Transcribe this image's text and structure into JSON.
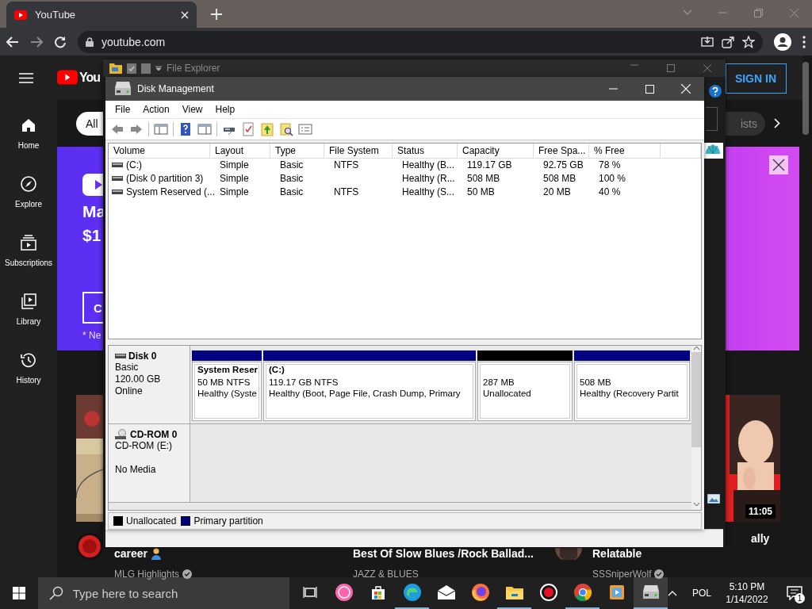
{
  "browser": {
    "tab": {
      "title": "YouTube"
    },
    "address": "youtube.com"
  },
  "youtube": {
    "logo_text": "You",
    "sign_in": "SIGN IN",
    "sidebar": [
      {
        "kind": "home",
        "label": "Home"
      },
      {
        "kind": "explore",
        "label": "Explore"
      },
      {
        "kind": "subscriptions",
        "label": "Subscriptions"
      },
      {
        "kind": "library",
        "label": "Library"
      },
      {
        "kind": "history",
        "label": "History"
      }
    ],
    "chips": [
      "All",
      "ists"
    ],
    "banner": {
      "heading_lines": [
        "Ma",
        "$1"
      ],
      "button": "C",
      "note": "* Ne"
    },
    "duration": "11:05",
    "videos": [
      {
        "title": "career",
        "channel": "MLG Highlights"
      },
      {
        "title": "Best Of Slow Blues /Rock Ballad...",
        "channel": "JAZZ & BLUES"
      },
      {
        "title_fragment": "ally",
        "title": "Relatable",
        "channel": "SSSniperWolf"
      }
    ]
  },
  "file_explorer": {
    "title": "File Explorer"
  },
  "disk_management": {
    "title": "Disk Management",
    "menu": [
      "File",
      "Action",
      "View",
      "Help"
    ],
    "columns": [
      "Volume",
      "Layout",
      "Type",
      "File System",
      "Status",
      "Capacity",
      "Free Spa...",
      "% Free"
    ],
    "rows": [
      [
        "(C:)",
        "Simple",
        "Basic",
        "NTFS",
        "Healthy (B...",
        "119.17 GB",
        "92.75 GB",
        "78 %"
      ],
      [
        "(Disk 0 partition 3)",
        "Simple",
        "Basic",
        "",
        "Healthy (R...",
        "508 MB",
        "508 MB",
        "100 %"
      ],
      [
        "System Reserved (...",
        "Simple",
        "Basic",
        "NTFS",
        "Healthy (S...",
        "50 MB",
        "20 MB",
        "40 %"
      ]
    ],
    "disks": [
      {
        "kind": "disk",
        "name": "Disk 0",
        "lines": [
          "Basic",
          "120.00 GB",
          "Online"
        ],
        "partitions": [
          {
            "kind": "primary",
            "name": "System Reser",
            "lines": [
              "50 MB NTFS",
              "Healthy (Syste"
            ]
          },
          {
            "kind": "primary",
            "name": "(C:)",
            "lines": [
              "119.17 GB NTFS",
              "Healthy (Boot, Page File, Crash Dump, Primary"
            ]
          },
          {
            "kind": "unallocated",
            "lines": [
              "287 MB",
              "Unallocated"
            ]
          },
          {
            "kind": "primary",
            "lines": [
              "508 MB",
              "Healthy (Recovery Partit"
            ]
          }
        ]
      },
      {
        "kind": "cdrom",
        "name": "CD-ROM 0",
        "lines": [
          "CD-ROM (E:)",
          "No Media"
        ]
      }
    ],
    "legend": [
      {
        "label": "Unallocated",
        "color": "#000000"
      },
      {
        "label": "Primary partition",
        "color": "#000080"
      }
    ]
  },
  "taskbar": {
    "search_placeholder": "Type here to search",
    "apps": [
      {
        "kind": "taskview",
        "open": false,
        "active": false
      },
      {
        "kind": "osu",
        "open": false,
        "active": false
      },
      {
        "kind": "store",
        "open": false,
        "active": false
      },
      {
        "kind": "edge",
        "open": true,
        "active": false
      },
      {
        "kind": "mail",
        "open": false,
        "active": false
      },
      {
        "kind": "firefox",
        "open": false,
        "active": false
      },
      {
        "kind": "explorer",
        "open": true,
        "active": false
      },
      {
        "kind": "record",
        "open": false,
        "active": false
      },
      {
        "kind": "chrome",
        "open": true,
        "active": false
      },
      {
        "kind": "media",
        "open": false,
        "active": false
      },
      {
        "kind": "diskmgmt",
        "open": true,
        "active": true
      }
    ],
    "language": "POL",
    "time": "5:10 PM",
    "date": "1/14/2022",
    "notifications": "1"
  }
}
